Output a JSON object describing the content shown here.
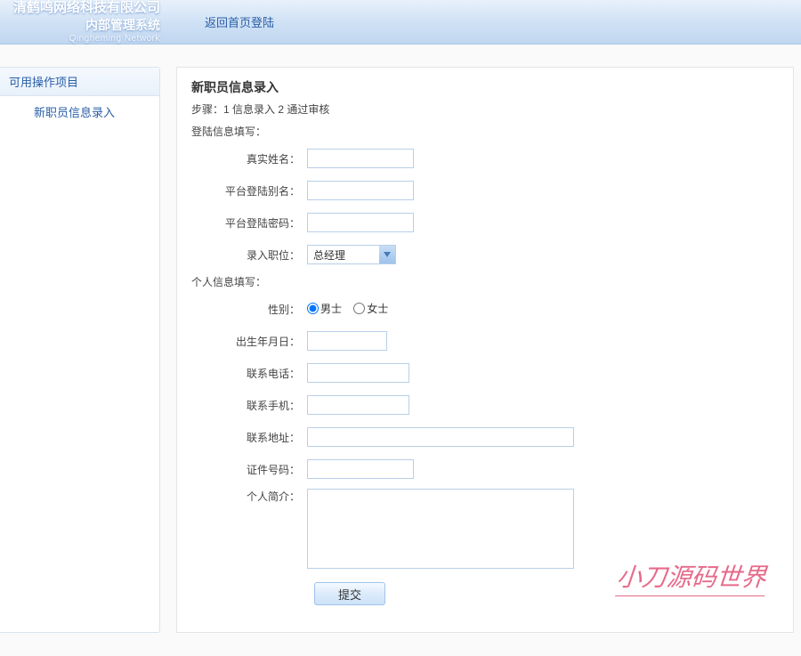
{
  "header": {
    "logo_main": "清鹤鸣网络科技有限公司",
    "logo_sub": "内部管理系统",
    "logo_en": "Qingheming Network",
    "back_link": "返回首页登陆"
  },
  "sidebar": {
    "title": "可用操作项目",
    "items": [
      {
        "label": "新职员信息录入"
      }
    ]
  },
  "form": {
    "title": "新职员信息录入",
    "steps": "步骤：1 信息录入 2 通过审核",
    "section_login": "登陆信息填写：",
    "section_personal": "个人信息填写：",
    "labels": {
      "real_name": "真实姓名：",
      "login_alias": "平台登陆别名：",
      "login_pwd": "平台登陆密码：",
      "position": "录入职位：",
      "gender": "性别：",
      "birthdate": "出生年月日：",
      "phone": "联系电话：",
      "mobile": "联系手机：",
      "address": "联系地址：",
      "id_number": "证件号码：",
      "bio": "个人简介："
    },
    "position_value": "总经理",
    "gender_options": {
      "male": "男士",
      "female": "女士"
    },
    "submit": "提交"
  },
  "watermark": "小刀源码世界"
}
